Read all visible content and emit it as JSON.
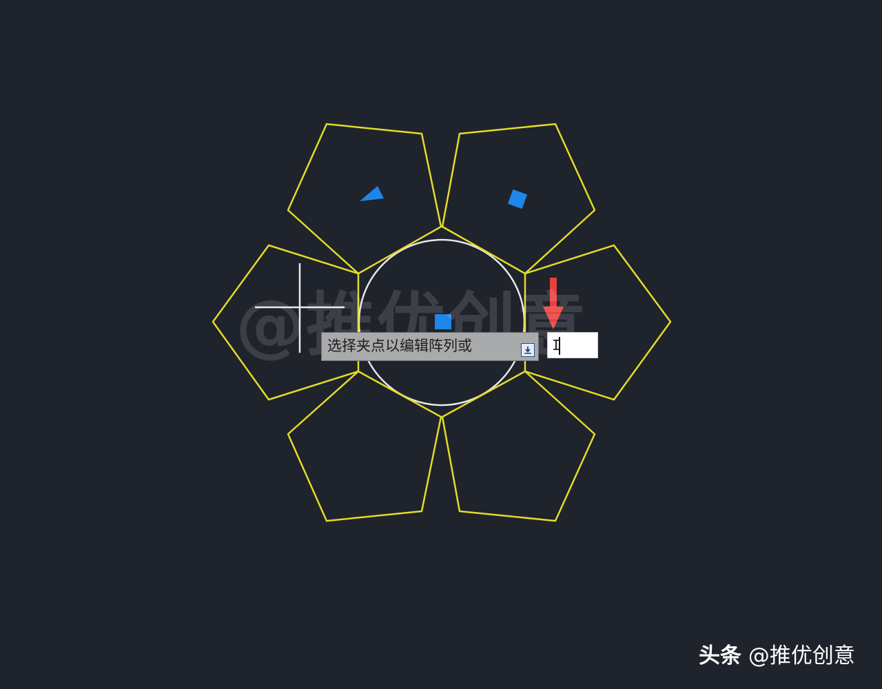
{
  "canvas": {
    "background": "#1f232b",
    "pentagon_color": "#e3dc2a",
    "circle_color": "#e6e8ee",
    "grip_color": "#1e86ea",
    "arrow_color": "#e8403b",
    "crosshair_color": "#e9ebef"
  },
  "watermark": {
    "center_text": "@推优创意"
  },
  "dynamic_input": {
    "prompt_text": "选择夹点以编辑阵列或",
    "expand_icon": "arrow-down-icon",
    "input_value": "I"
  },
  "footer_brand": {
    "platform": "头条",
    "account": "@推优创意"
  }
}
